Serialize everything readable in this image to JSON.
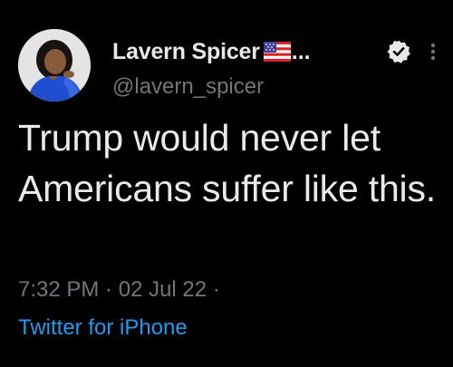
{
  "author": {
    "display_name": "Lavern Spicer",
    "flag_icon": "us-flag-icon",
    "truncation": "...",
    "handle": "@lavern_spicer",
    "verified_icon": "verified-badge-icon",
    "more_icon": "more-options-icon"
  },
  "tweet": {
    "text": "Trump would never let Americans suffer like this.",
    "time": "7:32 PM",
    "separator_1": " · ",
    "date": "02 Jul 22",
    "separator_2": " ·",
    "source": "Twitter for iPhone"
  },
  "colors": {
    "background": "#000000",
    "primary_text": "#e7e9ea",
    "secondary_text": "#71767b",
    "link": "#1d9bf0"
  }
}
